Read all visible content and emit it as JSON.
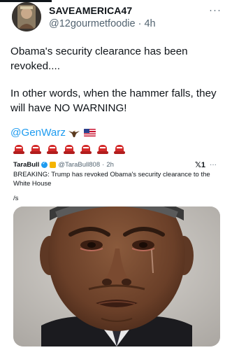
{
  "post": {
    "display_name": "SAVEAMERICA47",
    "handle": "@12gourmetfoodie",
    "time_sep": "·",
    "time": "4h",
    "more_label": "···",
    "text_paragraph_1": "Obama's security clearance has been revoked....",
    "text_paragraph_2": "In other words, when the hammer falls, they will have NO WARNING!",
    "mention": "@GenWarz",
    "mention_emojis": [
      "eagle-emoji",
      "us-flag-emoji"
    ],
    "hat_emojis": [
      "red-cap-emoji",
      "red-cap-emoji",
      "red-cap-emoji",
      "red-cap-emoji",
      "red-cap-emoji",
      "red-cap-emoji",
      "red-cap-emoji"
    ]
  },
  "quoted": {
    "name": "TaraBull",
    "handle": "@TaraBull808",
    "time_sep": "·",
    "time": "2h",
    "corner_label": "𝕏1",
    "more_label": "···",
    "body": "BREAKING: Trump has revoked Obama's security clearance to the White House",
    "trailer": "/s"
  },
  "colors": {
    "link": "#1d9bf0",
    "secondary_text": "#536471",
    "primary_text": "#0f1419"
  }
}
